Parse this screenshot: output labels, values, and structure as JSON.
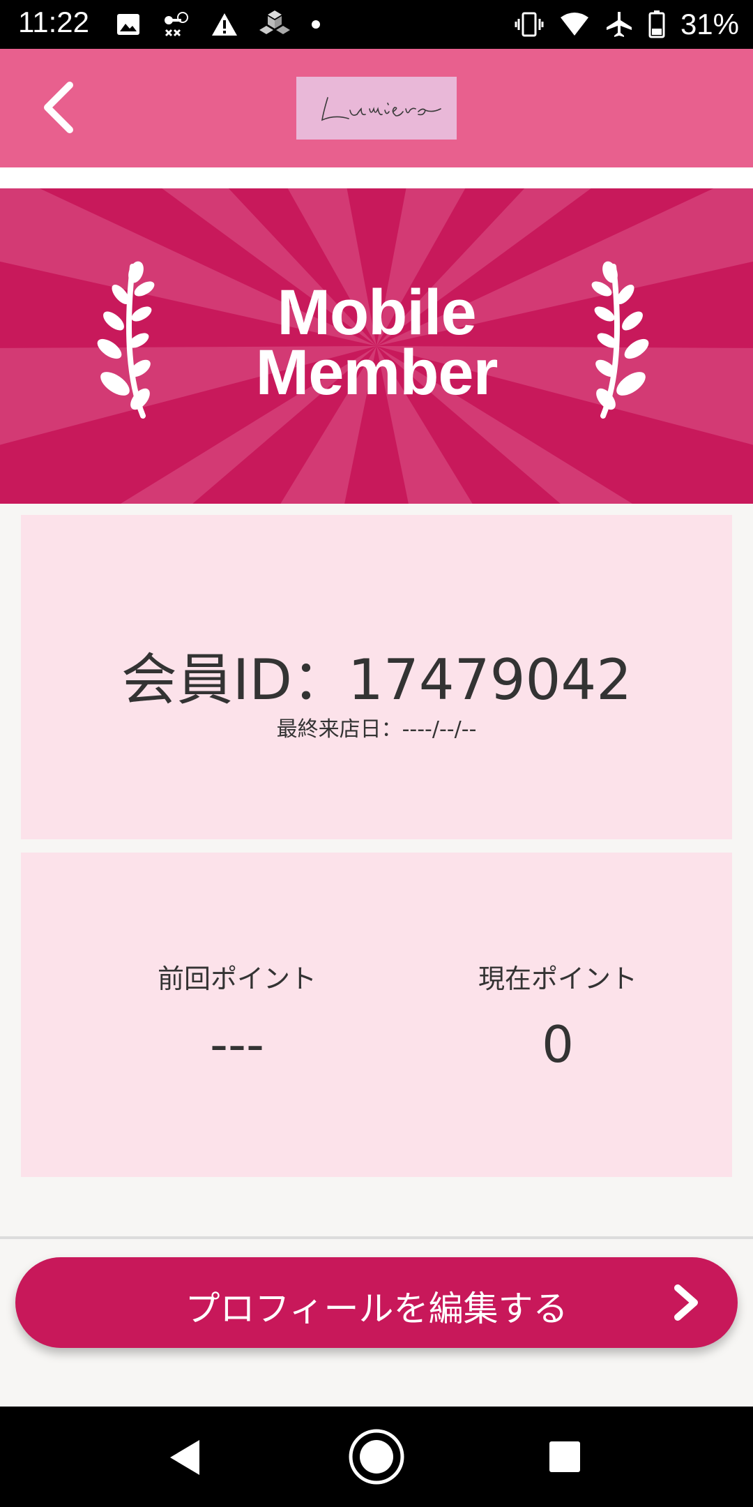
{
  "status_bar": {
    "time": "11:22",
    "battery_text": "31%",
    "icons": [
      "image-icon",
      "key-dollar-icon",
      "warning-icon",
      "cube-icon",
      "dot-icon",
      "vibrate-icon",
      "wifi-icon",
      "airplane-icon",
      "battery-icon"
    ]
  },
  "header": {
    "logo_text": "Lumière",
    "back_icon": "chevron-left-icon",
    "background": "#e8608e"
  },
  "banner": {
    "title_line1": "Mobile",
    "title_line2": "Member",
    "background": "#c8195b"
  },
  "member_card": {
    "member_id": "会員ID：17479042",
    "last_visit": "最終来店日：----/--/--"
  },
  "points_card": {
    "previous_label": "前回ポイント",
    "previous_value": "---",
    "current_label": "現在ポイント",
    "current_value": "0"
  },
  "action": {
    "edit_profile_label": "プロフィールを編集する",
    "accent": "#c8185a"
  },
  "nav_bar": {
    "icons": [
      "back-triangle-icon",
      "home-circle-icon",
      "recents-square-icon"
    ]
  }
}
